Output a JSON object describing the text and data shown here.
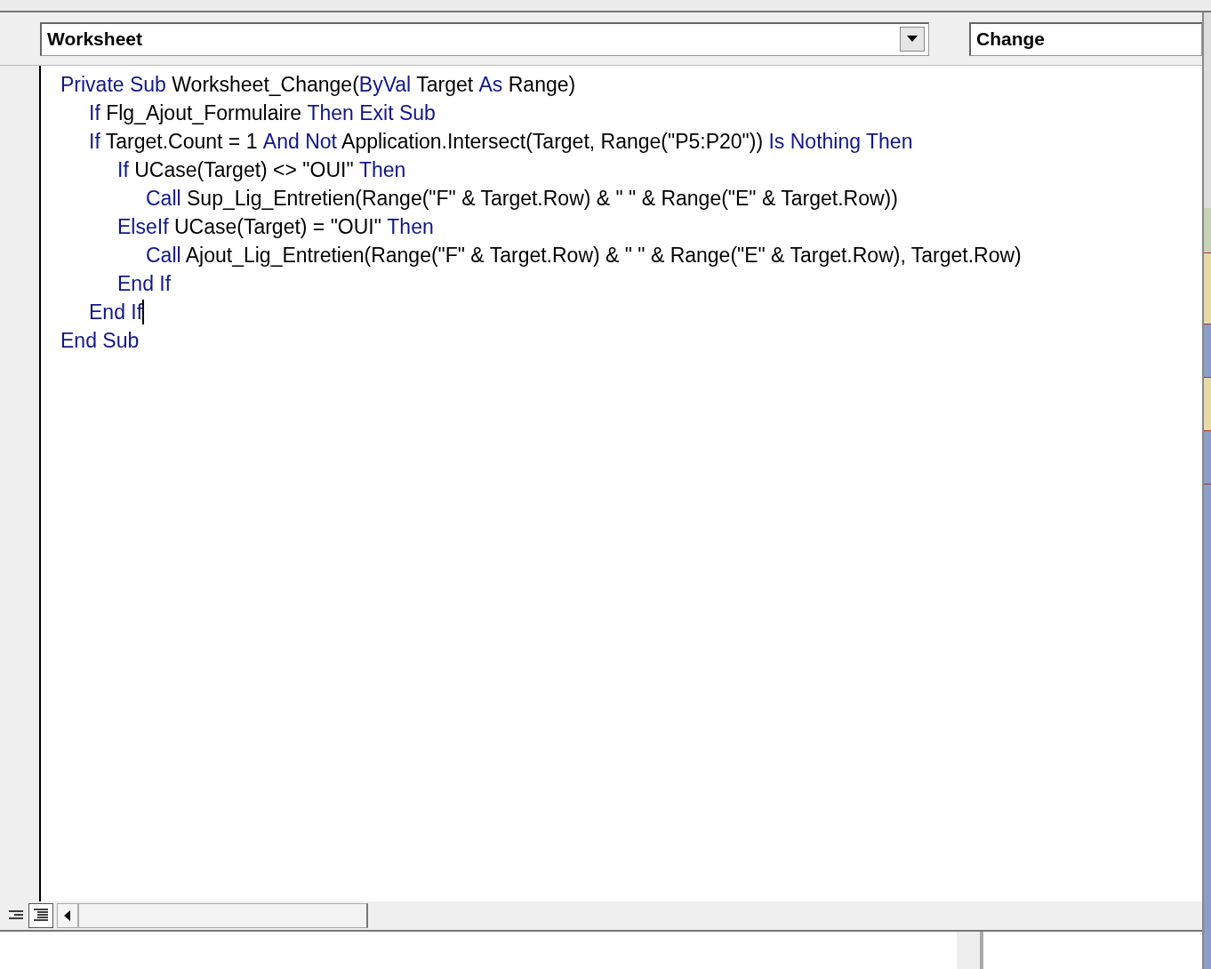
{
  "object_dropdown": {
    "value": "Worksheet"
  },
  "procedure_dropdown": {
    "value": "Change"
  },
  "code": [
    {
      "cursor": false,
      "tokens": [
        {
          "kind": "keyword",
          "text": "Private Sub"
        },
        {
          "kind": "plain",
          "text": " Worksheet_Change("
        },
        {
          "kind": "keyword",
          "text": "ByVal"
        },
        {
          "kind": "plain",
          "text": " Target "
        },
        {
          "kind": "keyword",
          "text": "As"
        },
        {
          "kind": "plain",
          "text": " Range)"
        }
      ],
      "children": [
        {
          "cursor": false,
          "tokens": [
            {
              "kind": "keyword",
              "text": "If"
            },
            {
              "kind": "plain",
              "text": " Flg_Ajout_Formulaire "
            },
            {
              "kind": "keyword",
              "text": "Then Exit Sub"
            }
          ]
        },
        {
          "cursor": false,
          "tokens": [
            {
              "kind": "keyword",
              "text": "If"
            },
            {
              "kind": "plain",
              "text": " Target.Count = 1 "
            },
            {
              "kind": "keyword",
              "text": "And Not"
            },
            {
              "kind": "plain",
              "text": " Application.Intersect(Target, Range(\"P5:P20\")) "
            },
            {
              "kind": "keyword",
              "text": "Is Nothing Then"
            }
          ],
          "children": [
            {
              "cursor": false,
              "tokens": [
                {
                  "kind": "keyword",
                  "text": "If"
                },
                {
                  "kind": "plain",
                  "text": " UCase(Target) <> \"OUI\" "
                },
                {
                  "kind": "keyword",
                  "text": "Then"
                }
              ],
              "children": [
                {
                  "cursor": false,
                  "tokens": [
                    {
                      "kind": "keyword",
                      "text": "Call"
                    },
                    {
                      "kind": "plain",
                      "text": " Sup_Lig_Entretien(Range(\"F\" & Target.Row) & \" \" & Range(\"E\" & Target.Row))"
                    }
                  ]
                }
              ]
            },
            {
              "cursor": false,
              "tokens": [
                {
                  "kind": "keyword",
                  "text": "ElseIf"
                },
                {
                  "kind": "plain",
                  "text": " UCase(Target) = \"OUI\" "
                },
                {
                  "kind": "keyword",
                  "text": "Then"
                }
              ],
              "children": [
                {
                  "cursor": false,
                  "tokens": [
                    {
                      "kind": "keyword",
                      "text": "Call"
                    },
                    {
                      "kind": "plain",
                      "text": " Ajout_Lig_Entretien(Range(\"F\" & Target.Row) & \" \" & Range(\"E\" & Target.Row), Target.Row)"
                    }
                  ]
                }
              ]
            },
            {
              "cursor": false,
              "tokens": [
                {
                  "kind": "keyword",
                  "text": "End If"
                }
              ]
            }
          ]
        },
        {
          "cursor": true,
          "tokens": [
            {
              "kind": "keyword",
              "text": "End If"
            }
          ]
        }
      ]
    },
    {
      "cursor": false,
      "tokens": [
        {
          "kind": "keyword",
          "text": "End Sub"
        }
      ]
    }
  ]
}
